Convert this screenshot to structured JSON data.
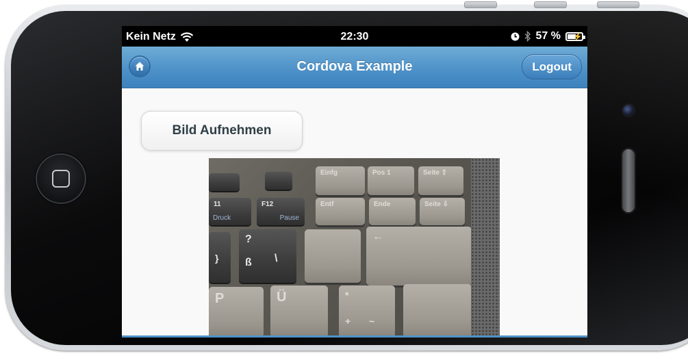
{
  "status_bar": {
    "carrier": "Kein Netz",
    "time": "22:30",
    "battery_percent": "57 %"
  },
  "header": {
    "title": "Cordova Example",
    "logout_label": "Logout"
  },
  "content": {
    "capture_button_label": "Bild Aufnehmen",
    "photo": {
      "key_labels": {
        "einfg": "Einfg",
        "pos1": "Pos 1",
        "seite_up": "Seite ⇧",
        "entf": "Entf",
        "ende": "Ende",
        "seite_down": "Seite ⇩",
        "f11_top": "11",
        "f11_sub": "Druck",
        "f12_top": "F12",
        "f12_sub": "Pause",
        "question": "?",
        "eszett": "ß",
        "backslash": "\\",
        "p": "P",
        "u_umlaut": "Ü",
        "plus": "+",
        "tilde": "~",
        "star": "*",
        "curly": "}",
        "arrow": "←"
      }
    }
  },
  "colors": {
    "header_blue": "#4e92c9",
    "status_black": "#000000",
    "page_bg": "#f9f9f9"
  },
  "icons": {
    "home": "home-icon",
    "wifi": "wifi-icon",
    "clock": "clock-icon",
    "bluetooth": "bluetooth-icon",
    "battery": "battery-charging-icon"
  }
}
